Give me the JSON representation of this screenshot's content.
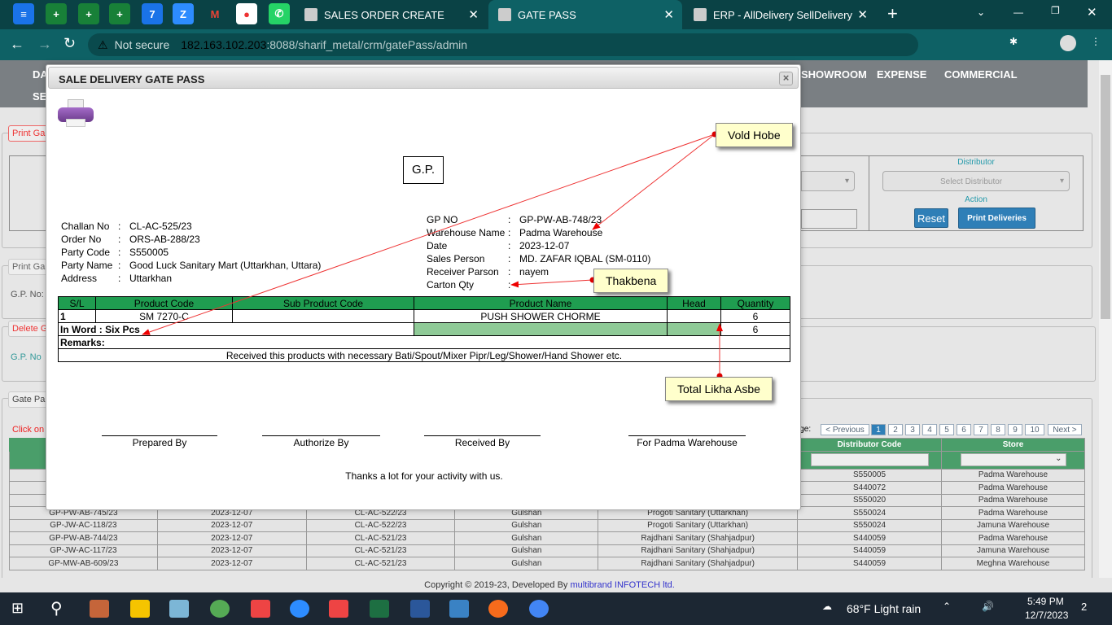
{
  "browser": {
    "tabs": [
      {
        "label": "SALES ORDER CREATE"
      },
      {
        "label": "GATE PASS"
      },
      {
        "label": "ERP - AllDelivery SellDelivery"
      }
    ],
    "security": "Not secure",
    "url_host": "182.163.102.203",
    "url_path": ":8088/sharif_metal/crm/gatePass/admin"
  },
  "nav": {
    "items": [
      "DA",
      "SE",
      "SHOWROOM",
      "EXPENSE",
      "COMMERCIAL"
    ]
  },
  "page": {
    "legends": [
      "Print Ga",
      "Print Ga",
      "Delete G",
      "Gate Pa"
    ],
    "gp_label": "G.P. No:",
    "gp_label2": "G.P. No",
    "distributor_label": "Distributor",
    "distributor_placeholder": "Select Distributor",
    "action_label": "Action",
    "reset": "Reset",
    "print_deliveries": "Print Deliveries",
    "click_note": "Click on",
    "page_label": "Page:",
    "pagination": [
      "< Previous",
      "1",
      "2",
      "3",
      "4",
      "5",
      "6",
      "7",
      "8",
      "9",
      "10",
      "Next >"
    ],
    "table_headers": {
      "distributor_code": "Distributor Code",
      "store": "Store"
    },
    "rows": [
      [
        "",
        "",
        "",
        "",
        "",
        "S550005",
        "Padma Warehouse"
      ],
      [
        "",
        "",
        "",
        "",
        "",
        "S440072",
        "Padma Warehouse"
      ],
      [
        "",
        "",
        "",
        "",
        "",
        "S550020",
        "Padma Warehouse"
      ],
      [
        "GP-PW-AB-745/23",
        "2023-12-07",
        "CL-AC-522/23",
        "Gulshan",
        "Progoti Sanitary (Uttarkhan)",
        "S550024",
        "Padma Warehouse"
      ],
      [
        "GP-JW-AC-118/23",
        "2023-12-07",
        "CL-AC-522/23",
        "Gulshan",
        "Progoti Sanitary (Uttarkhan)",
        "S550024",
        "Jamuna Warehouse"
      ],
      [
        "GP-PW-AB-744/23",
        "2023-12-07",
        "CL-AC-521/23",
        "Gulshan",
        "Rajdhani Sanitary (Shahjadpur)",
        "S440059",
        "Padma Warehouse"
      ],
      [
        "GP-JW-AC-117/23",
        "2023-12-07",
        "CL-AC-521/23",
        "Gulshan",
        "Rajdhani Sanitary (Shahjadpur)",
        "S440059",
        "Jamuna Warehouse"
      ],
      [
        "GP-MW-AB-609/23",
        "2023-12-07",
        "CL-AC-521/23",
        "Gulshan",
        "Rajdhani Sanitary (Shahjadpur)",
        "S440059",
        "Meghna Warehouse"
      ]
    ],
    "footer_prefix": "Copyright © 2019-23, Developed By ",
    "footer_link": "multibrand INFOTECH ltd."
  },
  "modal": {
    "title": "SALE DELIVERY GATE PASS",
    "close": "×",
    "gp_box": "G.P.",
    "left": [
      [
        "Challan No",
        ":",
        "CL-AC-525/23"
      ],
      [
        "Order No",
        ":",
        "ORS-AB-288/23"
      ],
      [
        "Party Code",
        ":",
        "S550005"
      ],
      [
        "Party Name",
        ":",
        "Good Luck Sanitary Mart (Uttarkhan, Uttara)"
      ],
      [
        "Address",
        ":",
        "Uttarkhan"
      ]
    ],
    "right": [
      [
        "GP NO",
        ":",
        "GP-PW-AB-748/23"
      ],
      [
        "Warehouse Name",
        ":",
        "Padma Warehouse"
      ],
      [
        "Date",
        ":",
        "2023-12-07"
      ],
      [
        "Sales Person",
        ":",
        "MD. ZAFAR IQBAL (SM-0110)"
      ],
      [
        "Receiver Parson",
        ":",
        "nayem"
      ],
      [
        "Carton Qty",
        ":",
        ""
      ]
    ],
    "table": {
      "headers": [
        "S/L",
        "Product Code",
        "Sub Product Code",
        "Product Name",
        "Head",
        "Quantity"
      ],
      "row": [
        "1",
        "SM 7270-C",
        "",
        "PUSH SHOWER CHORME",
        "",
        "6"
      ],
      "in_word": "In Word : Six Pcs",
      "total": "6",
      "remarks": "Remarks:",
      "note": "Received this products with necessary Bati/Spout/Mixer Pipr/Leg/Shower/Hand Shower etc."
    },
    "signatures": [
      "Prepared By",
      "Authorize By",
      "Received By",
      "For Padma Warehouse"
    ],
    "thanks": "Thanks a lot for your activity with us."
  },
  "annotations": [
    "Vold Hobe",
    "Thakbena",
    "Total Likha Asbe"
  ],
  "taskbar": {
    "weather": "68°F  Light rain",
    "time": "5:49 PM",
    "date": "12/7/2023",
    "notifications": "2"
  }
}
